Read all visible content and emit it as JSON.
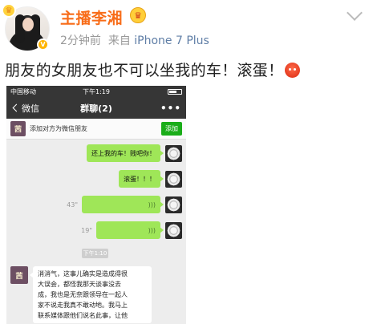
{
  "post": {
    "username": "主播李湘",
    "time_ago": "2分钟前",
    "source_prefix": "来自",
    "source_device": "iPhone 7 Plus",
    "text": "朋友的女朋友也不可以坐我的车！滚蛋！",
    "emoji": "angry-face"
  },
  "wechat": {
    "status": {
      "carrier": "中国移动",
      "time": "下午1:19"
    },
    "nav": {
      "back_label": "微信",
      "title": "群聊(2)",
      "more": "•••"
    },
    "add_friend": {
      "avatar_text": "茜",
      "text": "添加对方为微信朋友",
      "button": "添加"
    },
    "messages": [
      {
        "type": "text",
        "text": "还上我的车！贱吧你！"
      },
      {
        "type": "text",
        "text": "滚蛋！！！"
      },
      {
        "type": "voice",
        "duration": "43\""
      },
      {
        "type": "voice",
        "duration": "19\""
      }
    ],
    "timestamp": "下午1:10",
    "incoming": {
      "avatar_text": "茜",
      "text": "消消气，这事儿确实是造成得很\n大误会，都怪我那天谈事没去\n成，我也是无奈跟领导在一起人\n家不说走我真不敢动地。我马上\n联系媒体跟他们说名此事，让他"
    }
  }
}
